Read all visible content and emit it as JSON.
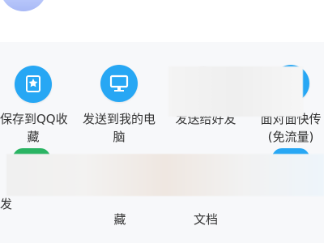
{
  "share_panel": {
    "row1": [
      {
        "label_line1": "保存到QQ收",
        "label_line2": "藏",
        "icon": "qq-favorites-icon"
      },
      {
        "label_line1": "发送到我的电",
        "label_line2": "脑",
        "icon": "computer-monitor-icon"
      },
      {
        "label_line1": "发送给好友",
        "label_line2": "",
        "icon": "send-to-friend-icon"
      },
      {
        "label_line1": "面对面快传",
        "label_line2": "(免流量)",
        "icon": "face-to-face-transfer-icon"
      }
    ],
    "row2": [
      {
        "label": "发",
        "icon": "green-app-icon"
      },
      {
        "label": "藏",
        "icon": "favorites-icon"
      },
      {
        "label": "文档",
        "icon": "document-icon"
      }
    ]
  },
  "colors": {
    "icon_blue": "#27a7f4",
    "icon_green": "#2ab463",
    "panel_background": "#f7f8fa"
  }
}
